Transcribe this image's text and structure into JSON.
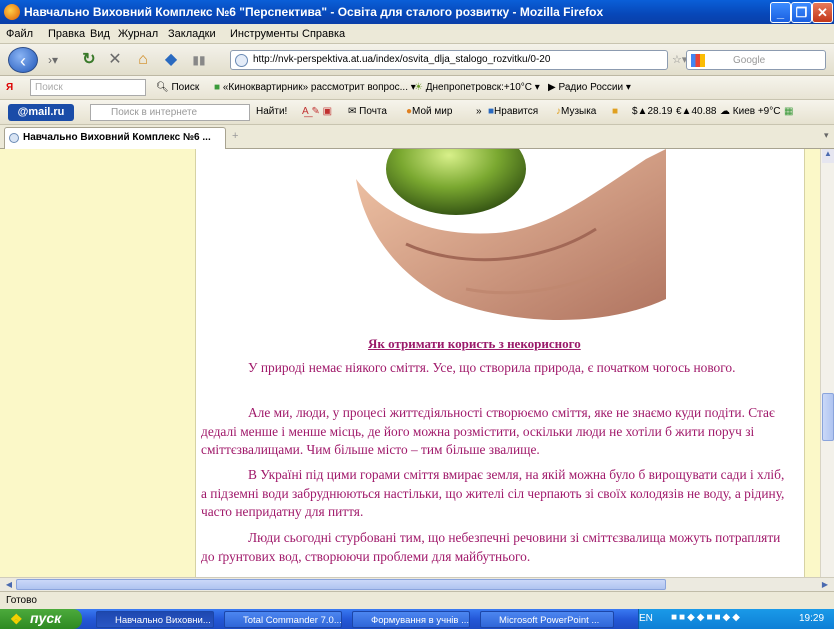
{
  "window": {
    "title": "Навчально Виховний Комплекс №6 \"Перспектива\" - Освіта для сталого розвитку - Mozilla Firefox"
  },
  "menu": [
    "Файл",
    "Правка",
    "Вид",
    "Журнал",
    "Закладки",
    "Инструменты",
    "Справка"
  ],
  "nav": {
    "url": "http://nvk-perspektiva.at.ua/index/osvita_dlja_stalogo_rozvitku/0-20",
    "search_placeholder": "Google"
  },
  "bar1": {
    "yandex_placeholder": "Поиск",
    "search_label": "Поиск",
    "news": "«Кинокварти­рник» рассмотрит вопрос...",
    "weather": "Днепропетровск:+10°C",
    "radio": "Радио России"
  },
  "bar2": {
    "mailru": "@mail.ru",
    "search_placeholder": "Поиск в интернете",
    "find": "Найти!",
    "mail": "Почта",
    "myworld": "Мой мир",
    "like": "Нравится",
    "music": "Музыка",
    "usd": "28.19",
    "eur": "40.88",
    "city_weather": "Киев +9°C"
  },
  "tab": {
    "title": "Навчально Виховний Комплекс №6 ..."
  },
  "article": {
    "heading": "Як отримати користь з некорисного",
    "paragraphs": [
      "У природі немає ніякого сміття. Усе, що створила природа, є початком чогось нового.",
      "Але ми, люди, у процесі життєдіяльності створюємо сміття, яке не знаємо куди подіти. Стає дедалі менше і менше місць, де його можна розмістити, оскільки люди не хотіли б жити поруч зі сміттєзвалищами. Чим більше місто – тим більше звалище.",
      "В Україні під цими горами сміття вмирає земля, на якій можна було б вирощувати сади і хліб, а підземні води забруднюються настільки, що жителі сіл черпають зі своїх колодязів не воду, а рідину, часто непридатну для пиття.",
      "Люди сьогодні стурбовані тим, що небезпечні речовини зі сміттєзвалища можуть потрапляти до ґрунтових вод, створюючи проблеми для майбутнього."
    ]
  },
  "status": "Готово",
  "taskbar": {
    "start": "пуск",
    "tasks": [
      "Навчально Виховни...",
      "Total Commander 7.0...",
      "Формування в учнів ...",
      "Microsoft PowerPoint ..."
    ],
    "lang": "EN",
    "clock": "19:29"
  },
  "colors": {
    "title_bar": "#0747b8",
    "article_text": "#a0196a",
    "page_bg": "#fbf8c8",
    "taskbar": "#2458d8",
    "start": "#2e8a22"
  }
}
